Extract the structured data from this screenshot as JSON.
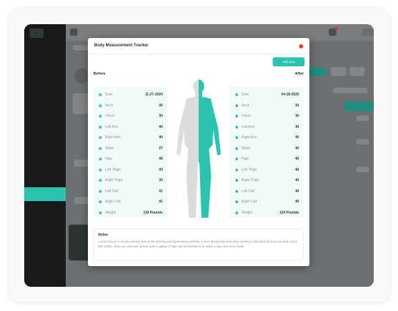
{
  "modal": {
    "title": "Body Measurement Tracker",
    "add_new_label": "Add New",
    "before_label": "Before",
    "after_label": "After",
    "notes_title": "Notes",
    "notes_text": "Lorem Ipsum is simply dummy text of the printing and typesetting industry. Lorem Ipsum has been the industry's standard dummy text ever since the 1500s, when an unknown printer took a galley of type and scrambled it to make a type specimen book."
  },
  "before": [
    {
      "label": "Date",
      "value": "11-27-2024"
    },
    {
      "label": "Neck",
      "value": "30"
    },
    {
      "label": "Chest",
      "value": "30"
    },
    {
      "label": "Left Arm",
      "value": "40"
    },
    {
      "label": "Right Arm",
      "value": "40"
    },
    {
      "label": "Waist",
      "value": "27"
    },
    {
      "label": "Hips",
      "value": "40"
    },
    {
      "label": "Left Thigh",
      "value": "30"
    },
    {
      "label": "Right Thigh",
      "value": "30"
    },
    {
      "label": "Left Calf",
      "value": "41"
    },
    {
      "label": "Right Calf",
      "value": "41"
    },
    {
      "label": "Weight",
      "value": "130 Pounds"
    }
  ],
  "after": [
    {
      "label": "Date",
      "value": "04-18-2025"
    },
    {
      "label": "Neck",
      "value": "30"
    },
    {
      "label": "Chest",
      "value": "30"
    },
    {
      "label": "Left Arm",
      "value": "40"
    },
    {
      "label": "Right Arm",
      "value": "40"
    },
    {
      "label": "Waist",
      "value": "40"
    },
    {
      "label": "Hips",
      "value": "40"
    },
    {
      "label": "Left Thigh",
      "value": "40"
    },
    {
      "label": "Right Thigh",
      "value": "40"
    },
    {
      "label": "Left Calf",
      "value": "40"
    },
    {
      "label": "Right Calf",
      "value": "40"
    },
    {
      "label": "Weight",
      "value": "124 Pounds"
    }
  ],
  "colors": {
    "accent": "#2bc4b0",
    "sidebar": "#17191b",
    "close": "#e0392a"
  },
  "icons": {
    "close": "close-icon",
    "figure": "body-figure-icon"
  }
}
